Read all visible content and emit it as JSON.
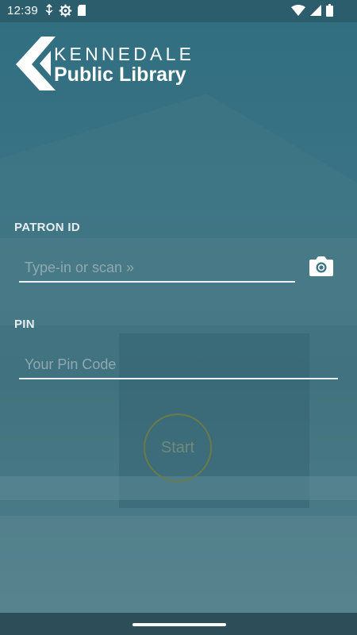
{
  "status_bar": {
    "time": "12:39",
    "left_icons": [
      "usb-debug-icon",
      "settings-gear-icon",
      "sd-card-icon"
    ],
    "right_icons": [
      "wifi-icon",
      "cell-signal-icon",
      "battery-icon"
    ]
  },
  "logo": {
    "line1": "KENNEDALE",
    "line2": "Public Library"
  },
  "form": {
    "patron_id_label": "PATRON ID",
    "patron_id_placeholder": "Type-in or scan »",
    "patron_id_value": "",
    "pin_label": "PIN",
    "pin_placeholder": "Your Pin Code",
    "pin_value": "",
    "start_label": "Start"
  },
  "colors": {
    "background": "#3a7385",
    "status_bar": "#2b5d6c",
    "nav_bar": "#2d4e59",
    "start_ring": "#6b7a4a"
  }
}
